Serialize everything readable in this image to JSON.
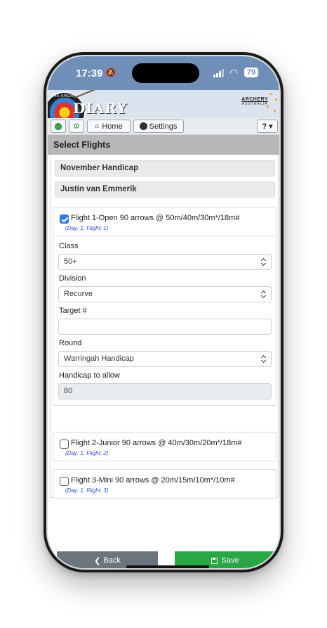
{
  "status_bar": {
    "time": "17:39",
    "battery": "79"
  },
  "banner": {
    "archers_text": "THE ARCHERS",
    "diary_text": "DIARY",
    "logo_line1": "ARCHERY",
    "logo_line2": "AUSTRALIA"
  },
  "toolbar": {
    "home_label": "Home",
    "settings_label": "Settings",
    "help_label": "? ▾"
  },
  "page": {
    "title": "Select Flights",
    "event_name": "November Handicap",
    "archer_name": "Justin van Emmerik"
  },
  "flights": [
    {
      "title": "Flight 1-Open 90 arrows @ 50m/40m/30m*/18m#",
      "sub": "(Day: 1, Flight: 1)",
      "checked": true
    },
    {
      "title": "Flight 2-Junior 90 arrows @ 40m/30m/20m*/18m#",
      "sub": "(Day: 1, Flight: 2)",
      "checked": false
    },
    {
      "title": "Flight 3-Mini 90 arrows @ 20m/15m/10m*/10m#",
      "sub": "(Day: 1, Flight: 3)",
      "checked": false
    }
  ],
  "form": {
    "class_label": "Class",
    "class_value": "50+",
    "division_label": "Division",
    "division_value": "Recurve",
    "target_label": "Target #",
    "target_value": "",
    "round_label": "Round",
    "round_value": "Warringah Handicap",
    "handicap_label": "Handicap to allow",
    "handicap_value": "80"
  },
  "footer": {
    "back_label": "Back",
    "save_label": "Save"
  },
  "colors": {
    "status_bar": "#6f8fb8",
    "page_header": "#b7b7b7",
    "back_button": "#6c757d",
    "save_button": "#29a745",
    "checkbox": "#2f79e6",
    "flight_sub_text": "#2a4fd1"
  }
}
